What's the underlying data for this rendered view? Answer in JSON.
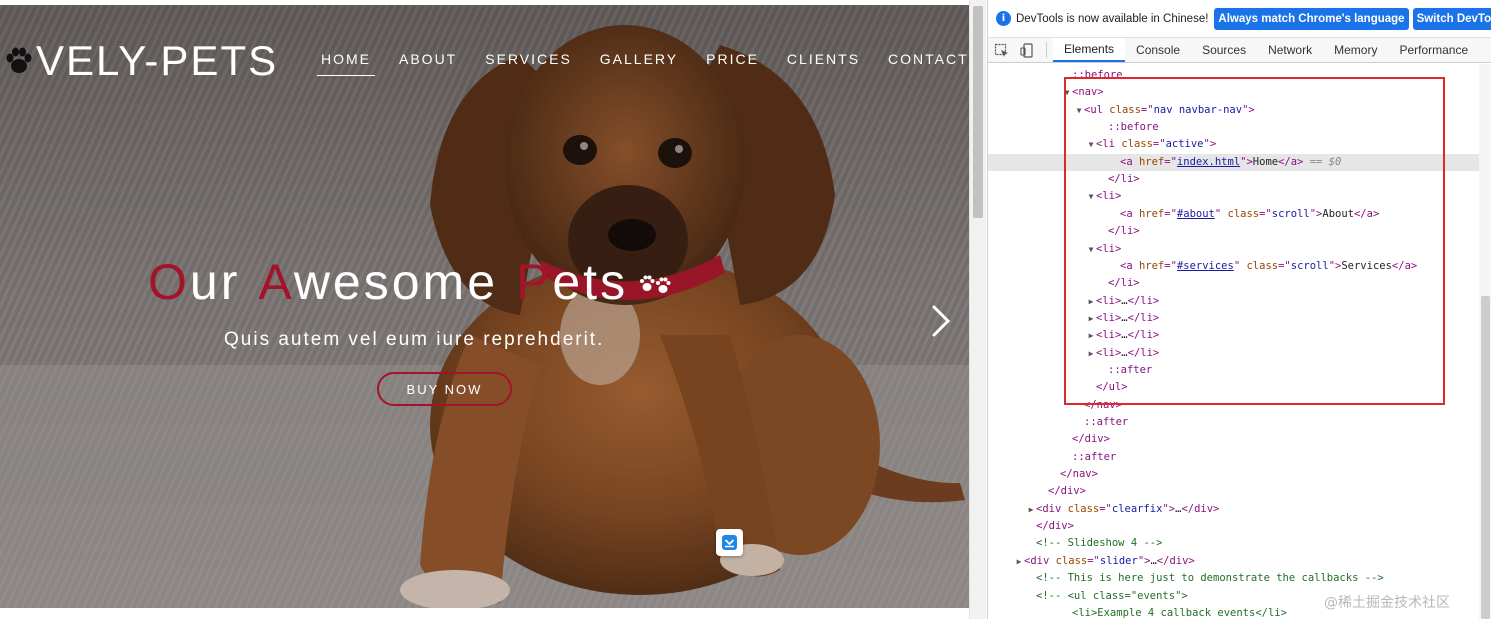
{
  "site": {
    "logo_text": "VELY-PETS",
    "nav": [
      {
        "label": "HOME",
        "active": true
      },
      {
        "label": "ABOUT"
      },
      {
        "label": "SERVICES"
      },
      {
        "label": "GALLERY"
      },
      {
        "label": "PRICE"
      },
      {
        "label": "CLIENTS"
      },
      {
        "label": "CONTACT"
      }
    ],
    "hero": {
      "title_words": [
        {
          "cap": "O",
          "rest": "ur"
        },
        {
          "cap": "A",
          "rest": "wesome"
        },
        {
          "cap": "P",
          "rest": "ets"
        }
      ],
      "subtitle": "Quis autem vel eum iure reprehderit.",
      "button_label": "BUY NOW"
    },
    "accent_color": "#a3132b"
  },
  "devtools": {
    "infobar": {
      "message": "DevTools is now available in Chinese!",
      "button_match": "Always match Chrome's language",
      "button_switch": "Switch DevTools to Chinese"
    },
    "tabs": [
      "Elements",
      "Console",
      "Sources",
      "Network",
      "Memory",
      "Performance"
    ],
    "active_tab": "Elements",
    "dom_lines": [
      {
        "indent": 86,
        "parts": [
          [
            "pseudo",
            "::before"
          ]
        ]
      },
      {
        "indent": 86,
        "tri": "open",
        "parts": [
          [
            "tag",
            "<nav>"
          ]
        ]
      },
      {
        "indent": 98,
        "tri": "open",
        "parts": [
          [
            "tag",
            "<ul "
          ],
          [
            "attr",
            "class"
          ],
          [
            "tag",
            "=\""
          ],
          [
            "val",
            "nav navbar-nav"
          ],
          [
            "tag",
            "\">"
          ]
        ]
      },
      {
        "indent": 122,
        "parts": [
          [
            "pseudo",
            "::before"
          ]
        ]
      },
      {
        "indent": 110,
        "tri": "open",
        "parts": [
          [
            "tag",
            "<li "
          ],
          [
            "attr",
            "class"
          ],
          [
            "tag",
            "=\""
          ],
          [
            "val",
            "active"
          ],
          [
            "tag",
            "\">"
          ]
        ]
      },
      {
        "indent": 134,
        "selected": true,
        "parts": [
          [
            "tag",
            "<a "
          ],
          [
            "attr",
            "href"
          ],
          [
            "tag",
            "=\""
          ],
          [
            "link",
            "index.html"
          ],
          [
            "tag",
            "\">"
          ],
          [
            "txt",
            "Home"
          ],
          [
            "tag",
            "</a>"
          ],
          [
            "eq0",
            " == $0"
          ]
        ]
      },
      {
        "indent": 122,
        "parts": [
          [
            "tag",
            "</li>"
          ]
        ]
      },
      {
        "indent": 110,
        "tri": "open",
        "parts": [
          [
            "tag",
            "<li>"
          ]
        ]
      },
      {
        "indent": 134,
        "parts": [
          [
            "tag",
            "<a "
          ],
          [
            "attr",
            "href"
          ],
          [
            "tag",
            "=\""
          ],
          [
            "link",
            "#about"
          ],
          [
            "tag",
            "\" "
          ],
          [
            "attr",
            "class"
          ],
          [
            "tag",
            "=\""
          ],
          [
            "val",
            "scroll"
          ],
          [
            "tag",
            "\">"
          ],
          [
            "txt",
            "About"
          ],
          [
            "tag",
            "</a>"
          ]
        ]
      },
      {
        "indent": 122,
        "parts": [
          [
            "tag",
            "</li>"
          ]
        ]
      },
      {
        "indent": 110,
        "tri": "open",
        "parts": [
          [
            "tag",
            "<li>"
          ]
        ]
      },
      {
        "indent": 134,
        "parts": [
          [
            "tag",
            "<a "
          ],
          [
            "attr",
            "href"
          ],
          [
            "tag",
            "=\""
          ],
          [
            "link",
            "#services"
          ],
          [
            "tag",
            "\" "
          ],
          [
            "attr",
            "class"
          ],
          [
            "tag",
            "=\""
          ],
          [
            "val",
            "scroll"
          ],
          [
            "tag",
            "\">"
          ],
          [
            "txt",
            "Services"
          ],
          [
            "tag",
            "</a>"
          ]
        ]
      },
      {
        "indent": 122,
        "parts": [
          [
            "tag",
            "</li>"
          ]
        ]
      },
      {
        "indent": 110,
        "tri": "closed",
        "parts": [
          [
            "tag",
            "<li>"
          ],
          [
            "txt",
            "…"
          ],
          [
            "tag",
            "</li>"
          ]
        ]
      },
      {
        "indent": 110,
        "tri": "closed",
        "parts": [
          [
            "tag",
            "<li>"
          ],
          [
            "txt",
            "…"
          ],
          [
            "tag",
            "</li>"
          ]
        ]
      },
      {
        "indent": 110,
        "tri": "closed",
        "parts": [
          [
            "tag",
            "<li>"
          ],
          [
            "txt",
            "…"
          ],
          [
            "tag",
            "</li>"
          ]
        ]
      },
      {
        "indent": 110,
        "tri": "closed",
        "parts": [
          [
            "tag",
            "<li>"
          ],
          [
            "txt",
            "…"
          ],
          [
            "tag",
            "</li>"
          ]
        ]
      },
      {
        "indent": 122,
        "parts": [
          [
            "pseudo",
            "::after"
          ]
        ]
      },
      {
        "indent": 110,
        "parts": [
          [
            "tag",
            "</ul>"
          ]
        ]
      },
      {
        "indent": 98,
        "parts": [
          [
            "tag",
            "</nav>"
          ]
        ]
      },
      {
        "indent": 98,
        "parts": [
          [
            "pseudo",
            "::after"
          ]
        ]
      },
      {
        "indent": 86,
        "parts": [
          [
            "tag",
            "</div>"
          ]
        ]
      },
      {
        "indent": 86,
        "parts": [
          [
            "pseudo",
            "::after"
          ]
        ]
      },
      {
        "indent": 74,
        "parts": [
          [
            "tag",
            "</nav>"
          ]
        ]
      },
      {
        "indent": 62,
        "parts": [
          [
            "tag",
            "</div>"
          ]
        ]
      },
      {
        "indent": 50,
        "tri": "closed",
        "parts": [
          [
            "tag",
            "<div "
          ],
          [
            "attr",
            "class"
          ],
          [
            "tag",
            "=\""
          ],
          [
            "val",
            "clearfix"
          ],
          [
            "tag",
            "\">"
          ],
          [
            "txt",
            "…"
          ],
          [
            "tag",
            "</div>"
          ]
        ]
      },
      {
        "indent": 50,
        "parts": [
          [
            "tag",
            "</div>"
          ]
        ]
      },
      {
        "indent": 50,
        "parts": [
          [
            "cmt",
            "<!-- Slideshow 4 -->"
          ]
        ]
      },
      {
        "indent": 38,
        "tri": "closed",
        "parts": [
          [
            "tag",
            "<div "
          ],
          [
            "attr",
            "class"
          ],
          [
            "tag",
            "=\""
          ],
          [
            "val",
            "slider"
          ],
          [
            "tag",
            "\">"
          ],
          [
            "txt",
            "…"
          ],
          [
            "tag",
            "</div>"
          ]
        ]
      },
      {
        "indent": 50,
        "parts": [
          [
            "cmt",
            "<!-- This is here just to demonstrate the callbacks -->"
          ]
        ]
      },
      {
        "indent": 50,
        "parts": [
          [
            "cmt",
            "<!-- <ul class=\"events\">"
          ]
        ]
      },
      {
        "indent": 86,
        "parts": [
          [
            "cmt",
            "<li>Example 4 callback events</li>"
          ]
        ]
      }
    ]
  },
  "watermark": "@稀土掘金技术社区"
}
